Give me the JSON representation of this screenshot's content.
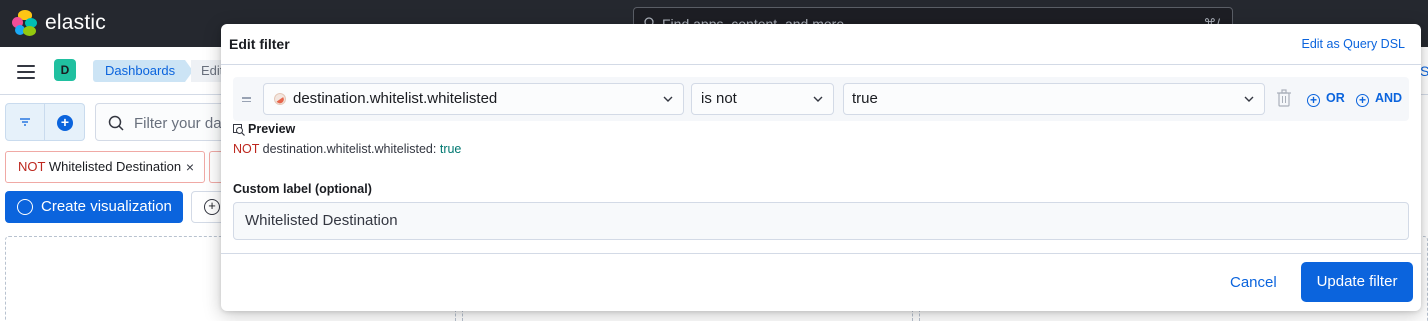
{
  "header": {
    "brand": "elastic",
    "search_placeholder": "Find apps, content, and more",
    "shortcut": "⌘/"
  },
  "subbar": {
    "space_initial": "D",
    "breadcrumbs": [
      "Dashboards",
      "Edit"
    ],
    "right_partial_link": "S"
  },
  "query_bar": {
    "placeholder": "Filter your data"
  },
  "filters": [
    {
      "negate_label": "NOT",
      "label": "Whitelisted Destination",
      "remove_symbol": "×"
    }
  ],
  "toolbar": {
    "create_visualization": "Create visualization"
  },
  "modal": {
    "title": "Edit filter",
    "query_dsl_link": "Edit as Query DSL",
    "field": "destination.whitelist.whitelisted",
    "operator": "is not",
    "value": "true",
    "or_label": "OR",
    "and_label": "AND",
    "preview_label": "Preview",
    "preview_not": "NOT",
    "preview_field": "destination.whitelist.whitelisted:",
    "preview_value": "true",
    "custom_label_title": "Custom label (optional)",
    "custom_label_value": "Whitelisted Destination",
    "cancel_label": "Cancel",
    "update_label": "Update filter"
  },
  "colors": {
    "accent": "#0b64dd",
    "negate": "#bd271e",
    "header_bg": "#25282f",
    "space_avatar": "#20c0a0"
  }
}
